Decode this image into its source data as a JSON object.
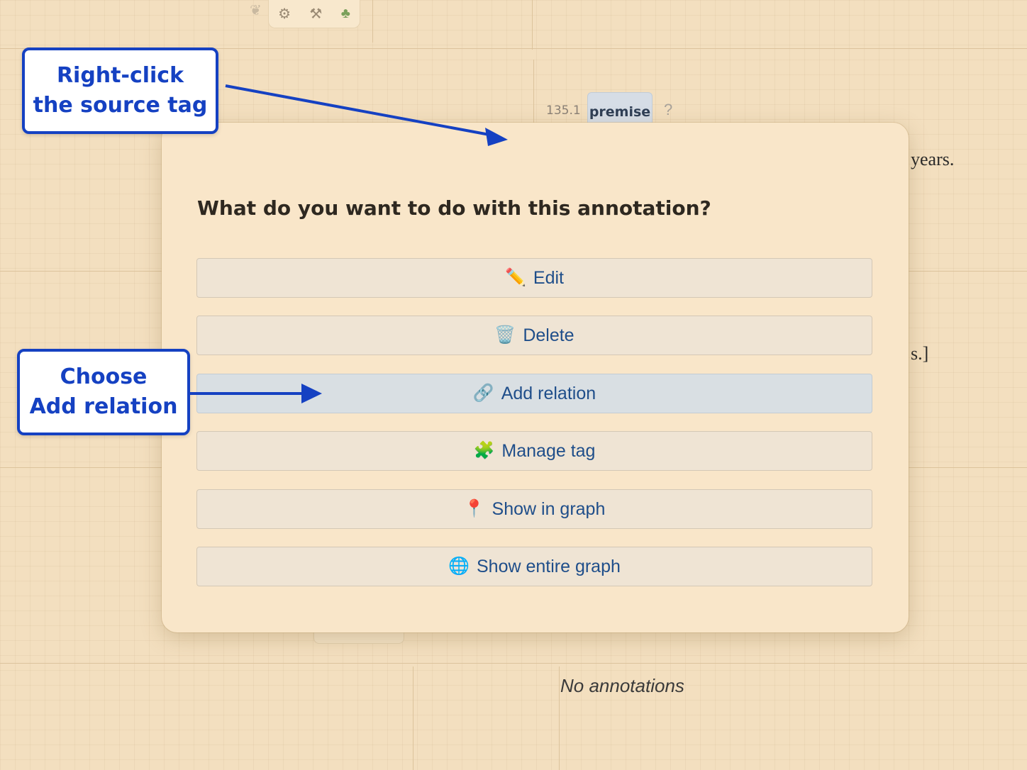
{
  "toolbar": {
    "icons": [
      "feather-icon",
      "gear-icon",
      "hammer-icon",
      "tree-icon"
    ]
  },
  "annotation": {
    "segment_number": "135.1",
    "tag_label": "premise",
    "help_mark": "?"
  },
  "background_text": {
    "line1_fragment": "years.",
    "line2_fragment": "s.]",
    "no_annotations": "No annotations"
  },
  "dialog": {
    "title": "What do you want to do with this annotation?",
    "options": [
      {
        "label": "Edit",
        "icon": "pencil-icon",
        "glyph": "✏️"
      },
      {
        "label": "Delete",
        "icon": "wastebasket-icon",
        "glyph": "🗑️"
      },
      {
        "label": "Add relation",
        "icon": "link-icon",
        "glyph": "🔗",
        "highlighted": true
      },
      {
        "label": "Manage tag",
        "icon": "puzzle-icon",
        "glyph": "🧩"
      },
      {
        "label": "Show in graph",
        "icon": "pushpin-icon",
        "glyph": "📍"
      },
      {
        "label": "Show entire graph",
        "icon": "globe-icon",
        "glyph": "🌐"
      }
    ]
  },
  "callouts": {
    "first": {
      "line1": "Right-click",
      "line2": "the source tag"
    },
    "second": {
      "line1": "Choose",
      "line2": "Add relation"
    }
  },
  "colors": {
    "background": "#f3dfbf",
    "modal": "#f9e6c9",
    "button_text": "#1f4e8a",
    "callout_accent": "#1541c2",
    "highlight_button": "#d9dfe3"
  }
}
